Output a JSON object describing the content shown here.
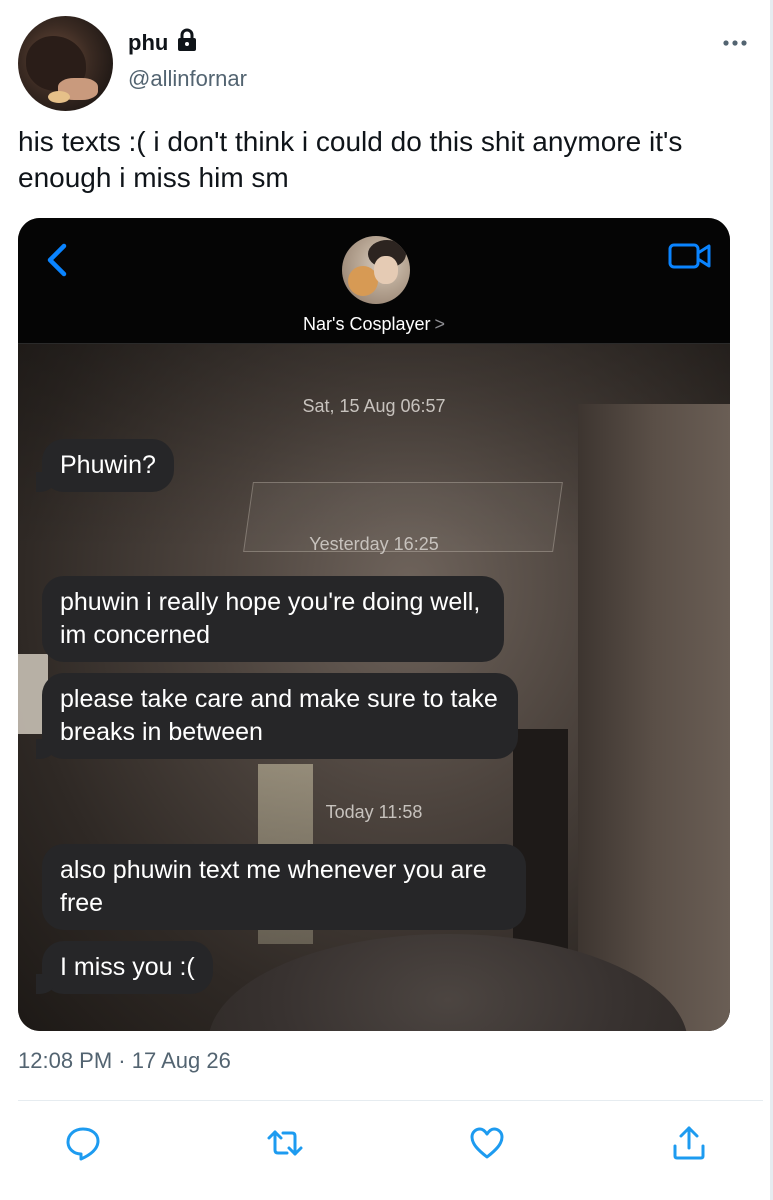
{
  "tweet": {
    "display_name": "phu",
    "handle": "@allinfornar",
    "text": "his texts :( i don't think i could do this shit anymore it's enough i miss him sm",
    "timestamp": "12:08 PM · 17 Aug 26"
  },
  "screenshot": {
    "contact_name": "Nar's Cosplayer",
    "contact_chevron": ">",
    "messages": [
      {
        "type": "time",
        "text": "Sat, 15 Aug 06:57"
      },
      {
        "type": "bubble",
        "text": "Phuwin?"
      },
      {
        "type": "time",
        "text": "Yesterday 16:25"
      },
      {
        "type": "bubble",
        "text": "phuwin i really hope you're doing well, im concerned"
      },
      {
        "type": "bubble",
        "text": "please take care and make sure to take breaks in between"
      },
      {
        "type": "time",
        "text": "Today 11:58"
      },
      {
        "type": "bubble",
        "text": "also phuwin text me whenever you are free"
      },
      {
        "type": "bubble",
        "text": "I miss you :("
      }
    ]
  },
  "icons": {
    "lock": "lock-icon",
    "more": "more-icon",
    "back": "back-icon",
    "video": "video-camera-icon",
    "reply": "reply-icon",
    "retweet": "retweet-icon",
    "like": "heart-icon",
    "share": "share-icon"
  },
  "colors": {
    "ios_blue": "#0a84ff",
    "bubble_gray": "#262628",
    "twitter_gray": "#536471",
    "twitter_blue": "#1d9bf0"
  }
}
